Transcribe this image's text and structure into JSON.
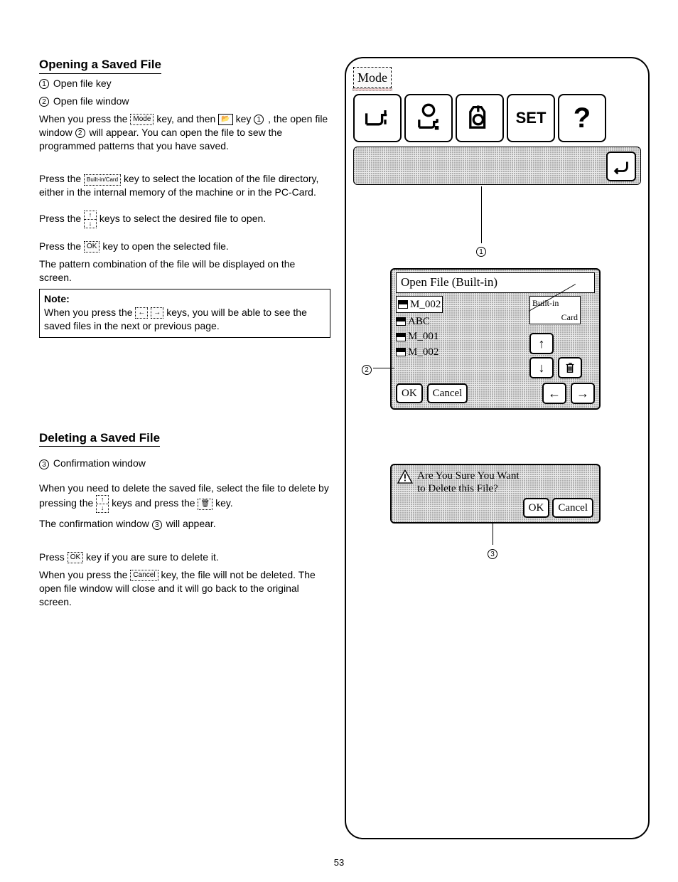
{
  "page_number": "53",
  "section1": {
    "heading": "Opening a Saved File",
    "bullets": [
      "Open file key",
      "Open file window"
    ],
    "p1a": "When you press the ",
    "p1b": " key, and then ",
    "p1c": " key ",
    "p1d": ", the open file window ",
    "p1e": " will appear. You can open the file to sew the programmed patterns that you have saved.",
    "p2a": "Press the ",
    "p2b": " key to select the location of the file directory, either in the internal memory of the machine or in the PC-Card.",
    "p3a": "Press the ",
    "p3b": " keys to select the desired file to open.",
    "p4a": "Press the ",
    "p4b": " key to open the selected file.",
    "p5": "The pattern combination of the file will be displayed on the screen.",
    "note_label": "Note:",
    "note_a": "When you press the ",
    "note_b": " keys, you will be able to see the saved files in the next or previous page."
  },
  "section2": {
    "heading": "Deleting a Saved File",
    "bullet": "Confirmation window",
    "p1a": "When you need to delete the saved file, select the file to delete by pressing the ",
    "p1b": " keys and press the ",
    "p1c": " key.",
    "p2a": "The confirmation window ",
    "p2b": " will appear.",
    "p3a": "Press ",
    "p3b": " key if you are sure to delete it.",
    "p4a": "When you press the ",
    "p4b": " key, the file will not be deleted. The open file window will close and it will go back to the original screen."
  },
  "diagram": {
    "mode_label": "Mode",
    "toolbar": {
      "set": "SET",
      "help": "?"
    },
    "callouts": {
      "c1": "1",
      "c2": "2",
      "c3": "3"
    },
    "openfile": {
      "title": "Open File  (Built-in)",
      "files": [
        "M_002",
        "ABC",
        "M_001",
        "M_002"
      ],
      "loc_builtin": "Built-in",
      "loc_card": "Card",
      "ok": "OK",
      "cancel": "Cancel"
    },
    "confirm": {
      "msg_line1": "Are You Sure You Want",
      "msg_line2": "to Delete this File?",
      "ok": "OK",
      "cancel": "Cancel"
    }
  },
  "inline_keys": {
    "mode": "Mode",
    "folder": "📂",
    "loc": "Built-in/Card",
    "ok": "OK",
    "cancel": "Cancel",
    "up": "↑",
    "down": "↓",
    "trash": "🗑",
    "prev": "←",
    "next": "→"
  }
}
